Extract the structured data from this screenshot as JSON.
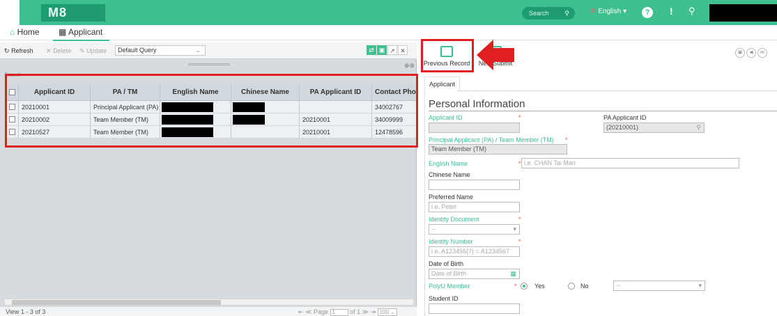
{
  "topbar": {
    "logo": "M8",
    "search_placeholder": "Search",
    "language": "English",
    "help": "?",
    "alert": "!"
  },
  "navtabs": {
    "home": "Home",
    "applicant": "Applicant"
  },
  "toolbar": {
    "refresh": "Refresh",
    "delete": "Delete",
    "update": "Update",
    "query": "Default Query"
  },
  "grid": {
    "search_label": "Search",
    "columns": [
      "Applicant ID",
      "PA / TM",
      "English Name",
      "Chinese Name",
      "PA Applicant ID",
      "Contact Phone"
    ],
    "rows": [
      [
        "20210001",
        "Principal Applicant (PA)",
        "",
        "",
        "",
        "34002767"
      ],
      [
        "20210002",
        "Team Member (TM)",
        "",
        "",
        "20210001",
        "34009999"
      ],
      [
        "20210527",
        "Team Member (TM)",
        "",
        "",
        "20210001",
        "12478596"
      ]
    ]
  },
  "pager": {
    "view": "View 1 - 3 of 3",
    "page_label": "Page",
    "page": "1",
    "of": "of 1",
    "size": "100"
  },
  "actions": {
    "previous": "Previous Record",
    "new": "New",
    "submit": "Submit"
  },
  "form": {
    "tab": "Applicant",
    "section": "Personal Information",
    "applicant_id_label": "Applicant ID",
    "pa_applicant_id_label": "PA Applicant ID",
    "pa_applicant_id_value": "(20210001)",
    "pa_tm_label": "Principal Applicant (PA) / Team Member (TM)",
    "pa_tm_value": "Team Member (TM)",
    "english_name_label": "English Name",
    "english_name_placeholder": "i.e. CHAN Tai Man",
    "chinese_name_label": "Chinese Name",
    "preferred_name_label": "Preferred Name",
    "preferred_name_placeholder": "i.e. Peter",
    "identity_document_label": "Identity Document",
    "identity_document_value": "--",
    "identity_number_label": "Identity Number",
    "identity_number_placeholder": "i.e. A123456(7) = A1234567",
    "dob_label": "Date of Birth",
    "dob_placeholder": "Date of Birth",
    "polyu_label": "PolyU Member",
    "polyu_yes": "Yes",
    "polyu_no": "No",
    "polyu_select": "--",
    "student_id_label": "Student ID"
  },
  "colors": {
    "accent": "#3dbf8f",
    "highlight": "#e02020"
  }
}
